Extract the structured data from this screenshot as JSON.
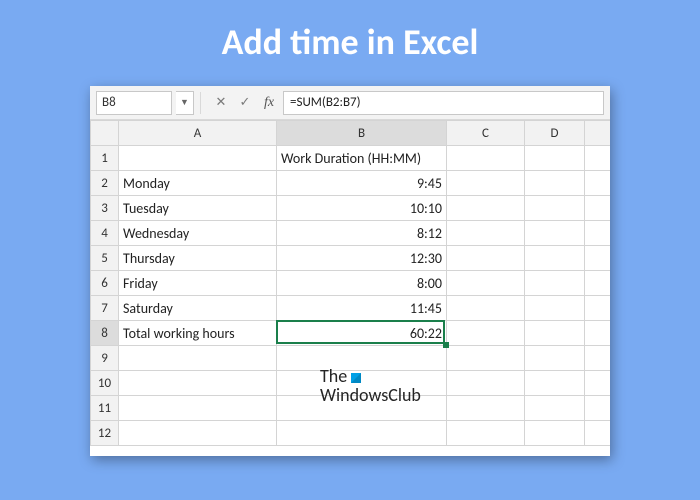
{
  "banner": {
    "title": "Add time in Excel"
  },
  "formula_bar": {
    "name_box": "B8",
    "formula": "=SUM(B2:B7)"
  },
  "columns": [
    "A",
    "B",
    "C",
    "D",
    ""
  ],
  "row_numbers": [
    "1",
    "2",
    "3",
    "4",
    "5",
    "6",
    "7",
    "8",
    "9",
    "10",
    "11",
    "12"
  ],
  "cells": {
    "B1": "Work Duration (HH:MM)",
    "A2": "Monday",
    "B2": "9:45",
    "A3": "Tuesday",
    "B3": "10:10",
    "A4": "Wednesday",
    "B4": "8:12",
    "A5": "Thursday",
    "B5": "12:30",
    "A6": "Friday",
    "B6": "8:00",
    "A7": "Saturday",
    "B7": "11:45",
    "A8": "Total working hours",
    "B8": "60:22"
  },
  "selection": {
    "cell": "B8"
  },
  "watermark": {
    "line1": "The",
    "line2": "WindowsClub"
  }
}
